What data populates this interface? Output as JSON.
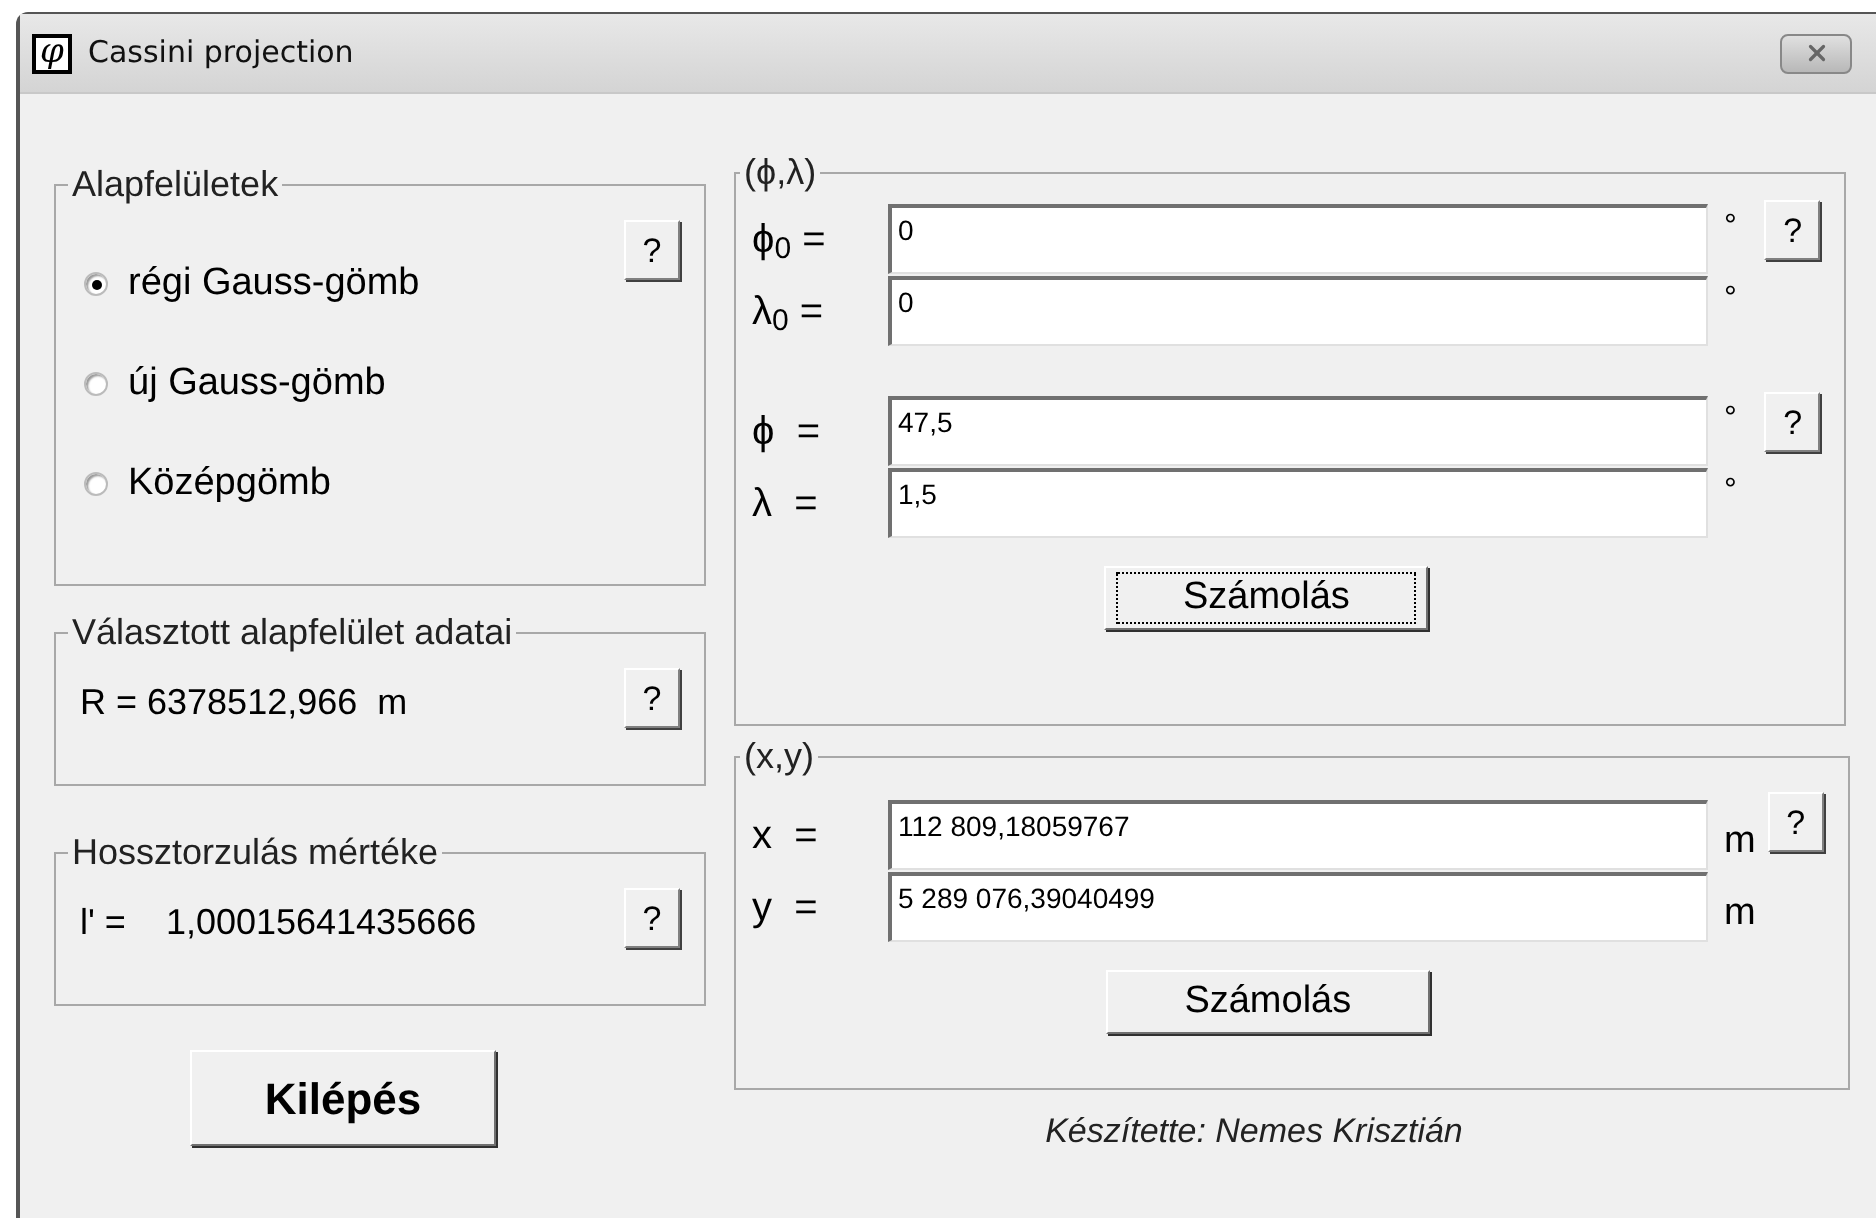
{
  "window": {
    "title": "Cassini projection",
    "app_icon": "φ"
  },
  "surfaces": {
    "title": "Alapfelületek",
    "help": "?",
    "options": [
      {
        "label": "régi Gauss-gömb",
        "selected": true
      },
      {
        "label": "új Gauss-gömb",
        "selected": false
      },
      {
        "label": "Középgömb",
        "selected": false
      }
    ]
  },
  "selected_surface": {
    "title": "Választott alapfelület adatai",
    "help": "?",
    "value": "R = 6378512,966",
    "unit": "m"
  },
  "distortion": {
    "title": "Hossztorzulás mértéke",
    "help": "?",
    "label": "l' =",
    "value": "1,00015641435666"
  },
  "exit_button": "Kilépés",
  "geographic": {
    "title": "(ϕ,λ)",
    "groups": [
      {
        "help": "?",
        "fields": [
          {
            "label": "ϕ$_{0}$ =",
            "value": "0",
            "unit": "°"
          },
          {
            "label": "λ$_{0}$ =",
            "value": "0",
            "unit": "°"
          }
        ]
      },
      {
        "help": "?",
        "fields": [
          {
            "label": "ϕ  =",
            "value": "47,5",
            "unit": "°"
          },
          {
            "label": "λ  =",
            "value": "1,5",
            "unit": "°"
          }
        ]
      }
    ],
    "button": {
      "label": "Számolás",
      "focused": true
    }
  },
  "projected": {
    "title": "(x,y)",
    "help": "?",
    "fields": [
      {
        "label": "x  =",
        "value": "112 809,18059767",
        "unit": "m"
      },
      {
        "label": "y  =",
        "value": "5 289 076,39040499",
        "unit": "m"
      }
    ],
    "button": {
      "label": "Számolás",
      "focused": false
    }
  },
  "author": "Készítette: Nemes Krisztián"
}
